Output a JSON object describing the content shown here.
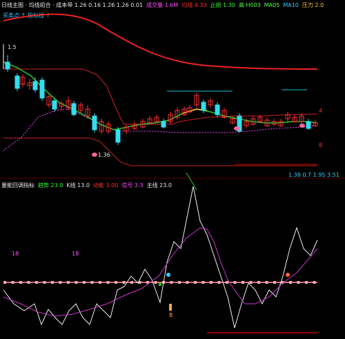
{
  "header": {
    "segments": [
      {
        "text": "日线主图 · 均线组合 · 成本带 1.26 0.16 1.26 1.26 0.01",
        "color": "#e8e8e8"
      },
      {
        "text": "成交量 1.6M",
        "color": "#ff4dff"
      },
      {
        "text": "均线 4.33",
        "color": "#ff3030"
      },
      {
        "text": "止损 1.30",
        "color": "#33ff33"
      },
      {
        "text": "高 H003",
        "color": "#4dff4d"
      },
      {
        "text": "MA05",
        "color": "#4dff4d"
      },
      {
        "text": "MA10",
        "color": "#33ccff"
      },
      {
        "text": "压力 2.0",
        "color": "#ffcc33"
      }
    ],
    "sub": "买卖点  ↑ 指标线 ↑"
  },
  "price_labels": {
    "top_left": "1.5",
    "right_upper": "4",
    "right_lower": "8",
    "low_point": "1.36",
    "bottom_right": "1.38 0.7 1.95 3.51"
  },
  "indicator": {
    "header": [
      {
        "text": "量能回调指标",
        "color": "#e8e8e8"
      },
      {
        "text": "趋势 23.0",
        "color": "#33ff33"
      },
      {
        "text": "K线 13.0",
        "color": "#e8e8e8"
      },
      {
        "text": "动能 3.00",
        "color": "#ff3030"
      },
      {
        "text": "信号 3.3",
        "color": "#ff4dff"
      },
      {
        "text": "主线 23.0",
        "color": "#e8e8e8"
      }
    ],
    "marks": {
      "left_a": "18",
      "left_b": "18",
      "below": "B"
    }
  },
  "colors": {
    "up": "#ff3030",
    "down": "#33ddee",
    "ma_green": "#22cc22",
    "band_red": "#cc0000",
    "ma_pink": "#ff4dff",
    "signal_pink": "#ff6699"
  }
}
